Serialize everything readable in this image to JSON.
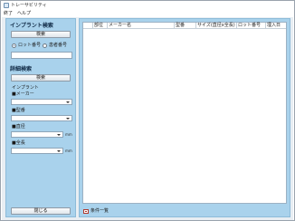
{
  "window": {
    "title": "トレーサビリティ"
  },
  "menu": [
    "終了",
    "ヘルプ"
  ],
  "implant_search": {
    "title": "インプラント検索",
    "button": "検索",
    "radio": [
      {
        "label": "ロット番号",
        "selected": true
      },
      {
        "label": "患者番号",
        "selected": false
      }
    ],
    "input_value": ""
  },
  "detail_search": {
    "title": "詳細検索",
    "button": "検索",
    "group_label": "インプラント",
    "fields": [
      {
        "label": "■メーカー",
        "value": "",
        "unit": ""
      },
      {
        "label": "■型番",
        "value": "",
        "unit": ""
      },
      {
        "label": "■直径",
        "value": "",
        "unit": "mm"
      },
      {
        "label": "■全長",
        "value": "",
        "unit": "mm"
      }
    ]
  },
  "close_button": "閉じる",
  "table": {
    "columns": [
      "部位",
      "メーカー名",
      "型番",
      "サイズ(直径x全長)",
      "ロット番号",
      "埋入日"
    ],
    "rows": []
  },
  "footer": {
    "label": "条件一覧"
  },
  "colors": {
    "panel": "#a9d2ec",
    "workspace": "#e8eef3"
  }
}
